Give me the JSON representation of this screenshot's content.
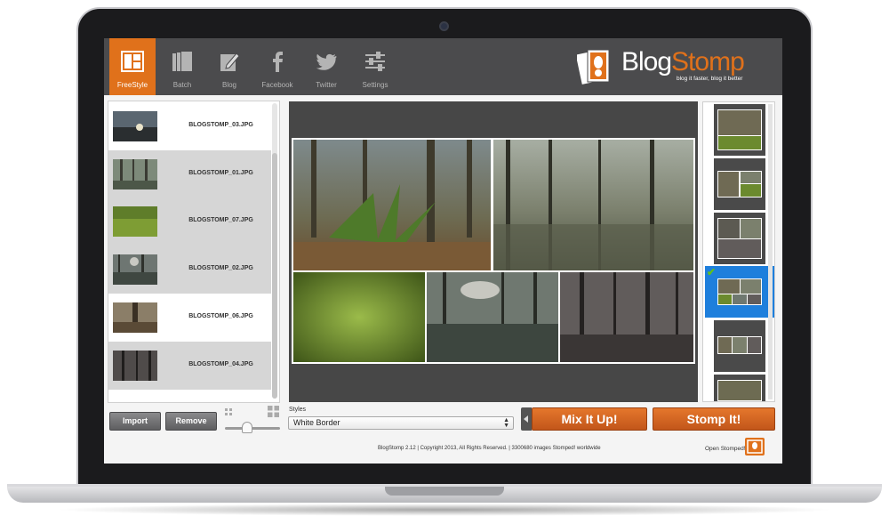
{
  "toolbar": {
    "items": [
      {
        "label": "FreeStyle",
        "icon": "freestyle-layout-icon",
        "active": true
      },
      {
        "label": "Batch",
        "icon": "batch-icon",
        "active": false
      },
      {
        "label": "Blog",
        "icon": "blog-edit-icon",
        "active": false
      },
      {
        "label": "Facebook",
        "icon": "facebook-icon",
        "active": false
      },
      {
        "label": "Twitter",
        "icon": "twitter-icon",
        "active": false
      },
      {
        "label": "Settings",
        "icon": "settings-sliders-icon",
        "active": false
      }
    ]
  },
  "logo": {
    "name_part1": "Blog",
    "name_part2": "Stomp",
    "tagline": "blog it faster, blog it better"
  },
  "file_list": {
    "files": [
      {
        "name": "BLOGSTOMP_03.JPG",
        "selected": false
      },
      {
        "name": "BLOGSTOMP_01.JPG",
        "selected": true
      },
      {
        "name": "BLOGSTOMP_07.JPG",
        "selected": true
      },
      {
        "name": "BLOGSTOMP_02.JPG",
        "selected": true
      },
      {
        "name": "BLOGSTOMP_06.JPG",
        "selected": false
      },
      {
        "name": "BLOGSTOMP_04.JPG",
        "selected": true
      }
    ]
  },
  "controls": {
    "import_label": "Import",
    "remove_label": "Remove",
    "styles_label": "Styles",
    "styles_value": "White Border",
    "mix_label": "Mix It Up!",
    "stomp_label": "Stomp It!",
    "thumb_size": 0.45
  },
  "footer": {
    "copyright": "BlogStomp 2.12 | Copyright 2013, All Rights Reserved. | 3300680 images Stomped! worldwide",
    "open_stomped": "Open Stomped!"
  },
  "layout_strip": {
    "selected_index": 3
  },
  "colors": {
    "accent": "#e0711b",
    "toolbar": "#4b4b4d",
    "selection": "#1e7fdc",
    "check": "#5fc21b"
  }
}
